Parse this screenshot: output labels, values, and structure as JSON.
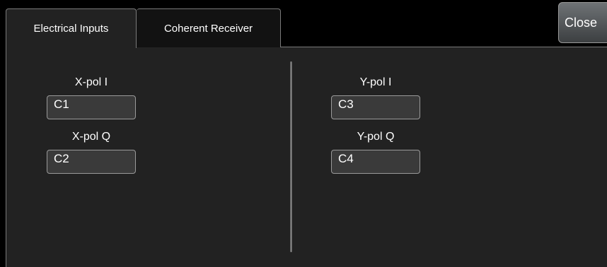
{
  "tabs": [
    {
      "label": "Electrical Inputs",
      "active": true
    },
    {
      "label": "Coherent Receiver",
      "active": false
    }
  ],
  "close_label": "Close",
  "x_pol": {
    "i_label": "X-pol I",
    "i_value": "C1",
    "q_label": "X-pol Q",
    "q_value": "C2"
  },
  "y_pol": {
    "i_label": "Y-pol I",
    "i_value": "C3",
    "q_label": "Y-pol Q",
    "q_value": "C4"
  }
}
